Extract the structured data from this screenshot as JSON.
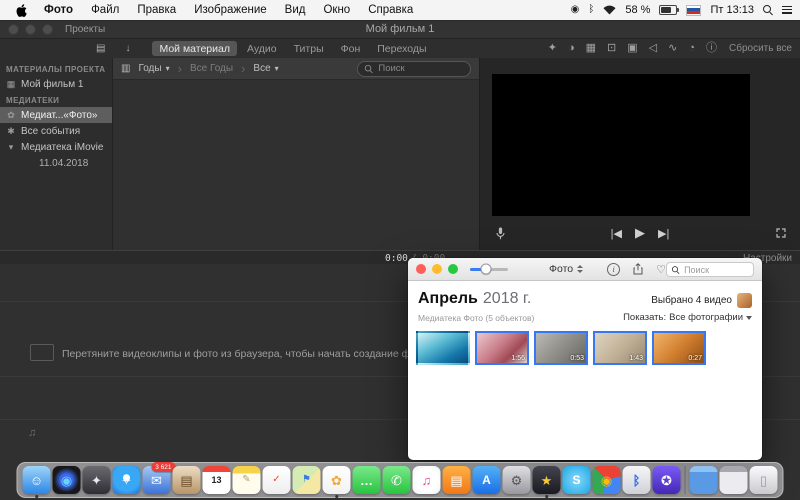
{
  "menu_bar": {
    "app_name": "Фото",
    "menus": [
      {
        "label": "Файл"
      },
      {
        "label": "Правка"
      },
      {
        "label": "Изображение"
      },
      {
        "label": "Вид"
      },
      {
        "label": "Окно"
      },
      {
        "label": "Справка"
      }
    ],
    "battery_percent": "58 %",
    "clock": "Пт 13:13"
  },
  "imovie": {
    "window_title": "Мой фильм 1",
    "back_button": "Проекты",
    "import_icons": [
      {
        "name": "import-media-icon",
        "glyph": "▤"
      },
      {
        "name": "download-icon",
        "glyph": "↓"
      }
    ],
    "tabs": [
      {
        "name": "tab-my-media",
        "label": "Мой материал",
        "cls": "active"
      },
      {
        "name": "tab-audio",
        "label": "Аудио",
        "cls": ""
      },
      {
        "name": "tab-titles",
        "label": "Титры",
        "cls": ""
      },
      {
        "name": "tab-backgrounds",
        "label": "Фон",
        "cls": ""
      },
      {
        "name": "tab-transitions",
        "label": "Переходы",
        "cls": ""
      }
    ],
    "viewer_tools": [
      {
        "name": "enhance-icon",
        "glyph": "✦"
      },
      {
        "name": "color-balance-icon",
        "glyph": "◑"
      },
      {
        "name": "color-correction-icon",
        "glyph": "▦"
      },
      {
        "name": "crop-icon",
        "glyph": "⊡"
      },
      {
        "name": "stabilization-icon",
        "glyph": "▣"
      },
      {
        "name": "volume-icon",
        "glyph": "◁"
      },
      {
        "name": "noise-reduction-icon",
        "glyph": "∿"
      },
      {
        "name": "speed-icon",
        "glyph": "◔"
      },
      {
        "name": "clip-info-icon",
        "glyph": "ⓘ"
      }
    ],
    "reset_all": "Сбросить все",
    "sidebar": {
      "section_project": "МАТЕРИАЛЫ ПРОЕКТА",
      "section_libraries": "МЕДИАТЕКИ",
      "project_items": [
        {
          "name": "sidebar-item-my-movie",
          "label": "Мой фильм 1",
          "icon": "▦",
          "cls": ""
        }
      ],
      "library_items": [
        {
          "name": "sidebar-item-photos-library",
          "label": "Медиат...«Фото»",
          "icon": "✿",
          "cls": "selected"
        },
        {
          "name": "sidebar-item-all-events",
          "label": "Все события",
          "icon": "✱",
          "cls": ""
        },
        {
          "name": "sidebar-item-imovie-library",
          "label": "Медиатека iMovie",
          "icon": "▾",
          "cls": ""
        },
        {
          "name": "sidebar-item-event-date",
          "label": "11.04.2018",
          "icon": "",
          "cls": "child"
        }
      ]
    },
    "filter": {
      "group_by": "Годы",
      "range": "Все Годы",
      "scope": "Все",
      "search_placeholder": "Поиск"
    },
    "timecode_current": "0:00",
    "timecode_total": "/ 0:00",
    "settings_label": "Настройки",
    "timeline_hint": "Перетяните видеоклипы и фото из браузера, чтобы начать создание фильма."
  },
  "photos": {
    "app_popup": "Фото",
    "search_placeholder": "Поиск",
    "month": "Апрель",
    "year": "2018 г.",
    "selection_status": "Выбрано 4 видео",
    "library_info": "Медиатека Фото (5 объектов)",
    "show_label": "Показать:",
    "show_value": "Все фотографии",
    "accent_color": "#3478f6",
    "thumbnails": [
      {
        "name": "thumbnail-photo",
        "duration": "",
        "cls": "",
        "style": "background:linear-gradient(150deg,#d8f2f4 0%,#5cbcd4 38%,#1678aa 72%,#0a4a80 100%)"
      },
      {
        "name": "thumbnail-video-1",
        "duration": "1:56",
        "cls": "selected",
        "style": "background:linear-gradient(135deg,#ecc9ce,#c87c88 45%,#a04a56 70%,#ded6d0 100%)"
      },
      {
        "name": "thumbnail-video-2",
        "duration": "0:53",
        "cls": "selected",
        "style": "background:linear-gradient(135deg,#bcbbb6,#908e88 50%,#666460 100%)"
      },
      {
        "name": "thumbnail-video-3",
        "duration": "1:43",
        "cls": "selected",
        "style": "background:linear-gradient(135deg,#e0d5c2,#c2b298 50%,#988870 100%)"
      },
      {
        "name": "thumbnail-video-4",
        "duration": "0:27",
        "cls": "selected",
        "style": "background:linear-gradient(135deg,#f2b46c,#d28030 50%,#904e16 100%)"
      }
    ]
  },
  "dock": {
    "apps": [
      {
        "name": "dock-item-finder",
        "glyph": "☺",
        "style": "background:linear-gradient(180deg,#9fd4f8,#2a86e8);color:#fff",
        "running": true
      },
      {
        "name": "dock-item-siri",
        "glyph": "◉",
        "style": "background:radial-gradient(circle at 50% 50%,#3a6af0 0 30%,#18181c 62%);color:#6ad4f8"
      },
      {
        "name": "dock-item-launchpad",
        "glyph": "✦",
        "style": "background:linear-gradient(180deg,#6a6a70,#2e2e34);color:#e8e8f0"
      },
      {
        "name": "dock-item-safari",
        "glyph": "✧",
        "style": "background:radial-gradient(circle at 50% 42%,#f4faff 0 16%,#38a8f4 17% 60%,#1a6ee0 100%);color:#fff"
      },
      {
        "name": "dock-item-mail",
        "glyph": "✉",
        "style": "background:linear-gradient(180deg,#a8c8f0,#3a72d8);color:#fff",
        "badge": "3 621"
      },
      {
        "name": "dock-item-contacts",
        "glyph": "▤",
        "style": "background:linear-gradient(180deg,#ecddc4,#b89468);color:#6a4a28"
      },
      {
        "name": "dock-item-calendar",
        "glyph": "13",
        "style": "background:linear-gradient(180deg,#f04438 0 22%,#ffffff 22%);color:#222;font-size:9px;font-weight:bold"
      },
      {
        "name": "dock-item-notes",
        "glyph": "✎",
        "style": "background:linear-gradient(180deg,#f6d44a 0 26%,#fffced 26%);color:#b0a070;font-size:10px"
      },
      {
        "name": "dock-item-reminders",
        "glyph": "✓",
        "style": "background:linear-gradient(180deg,#ffffff,#eeeeee);color:#e84a3a;font-size:10px"
      },
      {
        "name": "dock-item-maps",
        "glyph": "⚑",
        "style": "background:linear-gradient(135deg,#d4ecb4 0 52%,#f4e8a4 52%);color:#3a7ae0;font-size:10px"
      },
      {
        "name": "dock-item-photos",
        "glyph": "✿",
        "style": "background:linear-gradient(180deg,#ffffff,#f2f2f2);color:#f0a83a",
        "running": true
      },
      {
        "name": "dock-item-messages",
        "glyph": "…",
        "style": "background:linear-gradient(180deg,#7ae88a,#28c440);color:#fff;font-weight:bold"
      },
      {
        "name": "dock-item-facetime",
        "glyph": "✆",
        "style": "background:linear-gradient(180deg,#7ae88a,#28c440);color:#fff"
      },
      {
        "name": "dock-item-itunes",
        "glyph": "♫",
        "style": "background:radial-gradient(circle,#ffffff 55%,#f0f0f4 100%);color:#e8489a"
      },
      {
        "name": "dock-item-ibooks",
        "glyph": "▤",
        "style": "background:linear-gradient(180deg,#ffb044,#f07818);color:#fff"
      },
      {
        "name": "dock-item-app-store",
        "glyph": "A",
        "style": "background:linear-gradient(180deg,#54b0f4,#1a6ee8);color:#fff;font-weight:bold;font-size:12px"
      },
      {
        "name": "dock-item-system-preferences",
        "glyph": "⚙",
        "style": "background:linear-gradient(180deg,#e0e0e4,#98989e);color:#555"
      },
      {
        "name": "dock-item-imovie",
        "glyph": "★",
        "style": "background:linear-gradient(180deg,#44444e,#1a1a22);color:#f8c838",
        "running": true
      },
      {
        "name": "dock-item-skype",
        "glyph": "S",
        "style": "background:radial-gradient(circle,#8ad8f8,#18a8e8);color:#fff;font-weight:bold;font-size:12px"
      },
      {
        "name": "dock-item-chrome",
        "glyph": "◉",
        "style": "background:conic-gradient(from -45deg,#ea4335 0 120deg,#4285f4 0 240deg,#34a853 0 360deg);color:#fbbc05"
      },
      {
        "name": "dock-item-bluetooth-exchange",
        "glyph": "ᛒ",
        "style": "background:linear-gradient(180deg,#f6f6f8,#d0d0d8);color:#2a6ae8;font-weight:bold"
      },
      {
        "name": "dock-item-star-app",
        "glyph": "✪",
        "style": "background:linear-gradient(180deg,#7a5af4,#4428b8);color:#fff"
      }
    ],
    "extras": [
      {
        "name": "dock-item-downloads-folder",
        "glyph": "",
        "style": "background:linear-gradient(180deg,#8ec2f2 0 22%,#5a9ae4 22%);color:#fff"
      },
      {
        "name": "dock-item-window-preview",
        "glyph": "",
        "style": "background:linear-gradient(180deg,#a8a8b0 0 22%,#ececf0 22%);color:#666"
      },
      {
        "name": "dock-item-trash",
        "glyph": "▯",
        "style": "background:linear-gradient(180deg,#fbfbfd,#cacace);color:#99a"
      }
    ]
  }
}
